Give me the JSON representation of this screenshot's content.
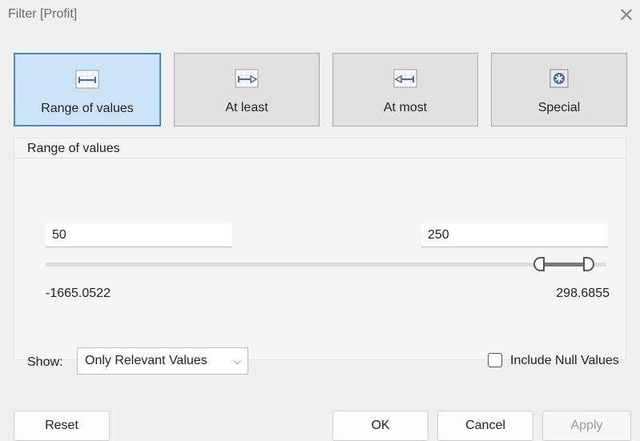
{
  "window": {
    "title": "Filter [Profit]",
    "close_glyph": "✕"
  },
  "modes": [
    {
      "label": "Range of values",
      "icon": "range-icon",
      "active": true
    },
    {
      "label": "At least",
      "icon": "at-least-icon",
      "active": false
    },
    {
      "label": "At most",
      "icon": "at-most-icon",
      "active": false
    },
    {
      "label": "Special",
      "icon": "special-icon",
      "active": false
    }
  ],
  "panel": {
    "title": "Range of values",
    "min_input": "50",
    "max_input": "250",
    "domain_min": "-1665.0522",
    "domain_max": "298.6855",
    "range_min_value": 50,
    "range_max_value": 250,
    "domain_min_value": -1665.0522,
    "domain_max_value": 298.6855
  },
  "show": {
    "label": "Show:",
    "selected": "Only Relevant Values",
    "chevron": "⌵"
  },
  "include_null": {
    "label": "Include Null Values",
    "checked": false
  },
  "buttons": {
    "reset": "Reset",
    "ok": "OK",
    "cancel": "Cancel",
    "apply": "Apply"
  },
  "colors": {
    "active_bg": "#cce4f7",
    "active_border": "#3c8ad3",
    "button_bg": "#e1e1e1"
  }
}
